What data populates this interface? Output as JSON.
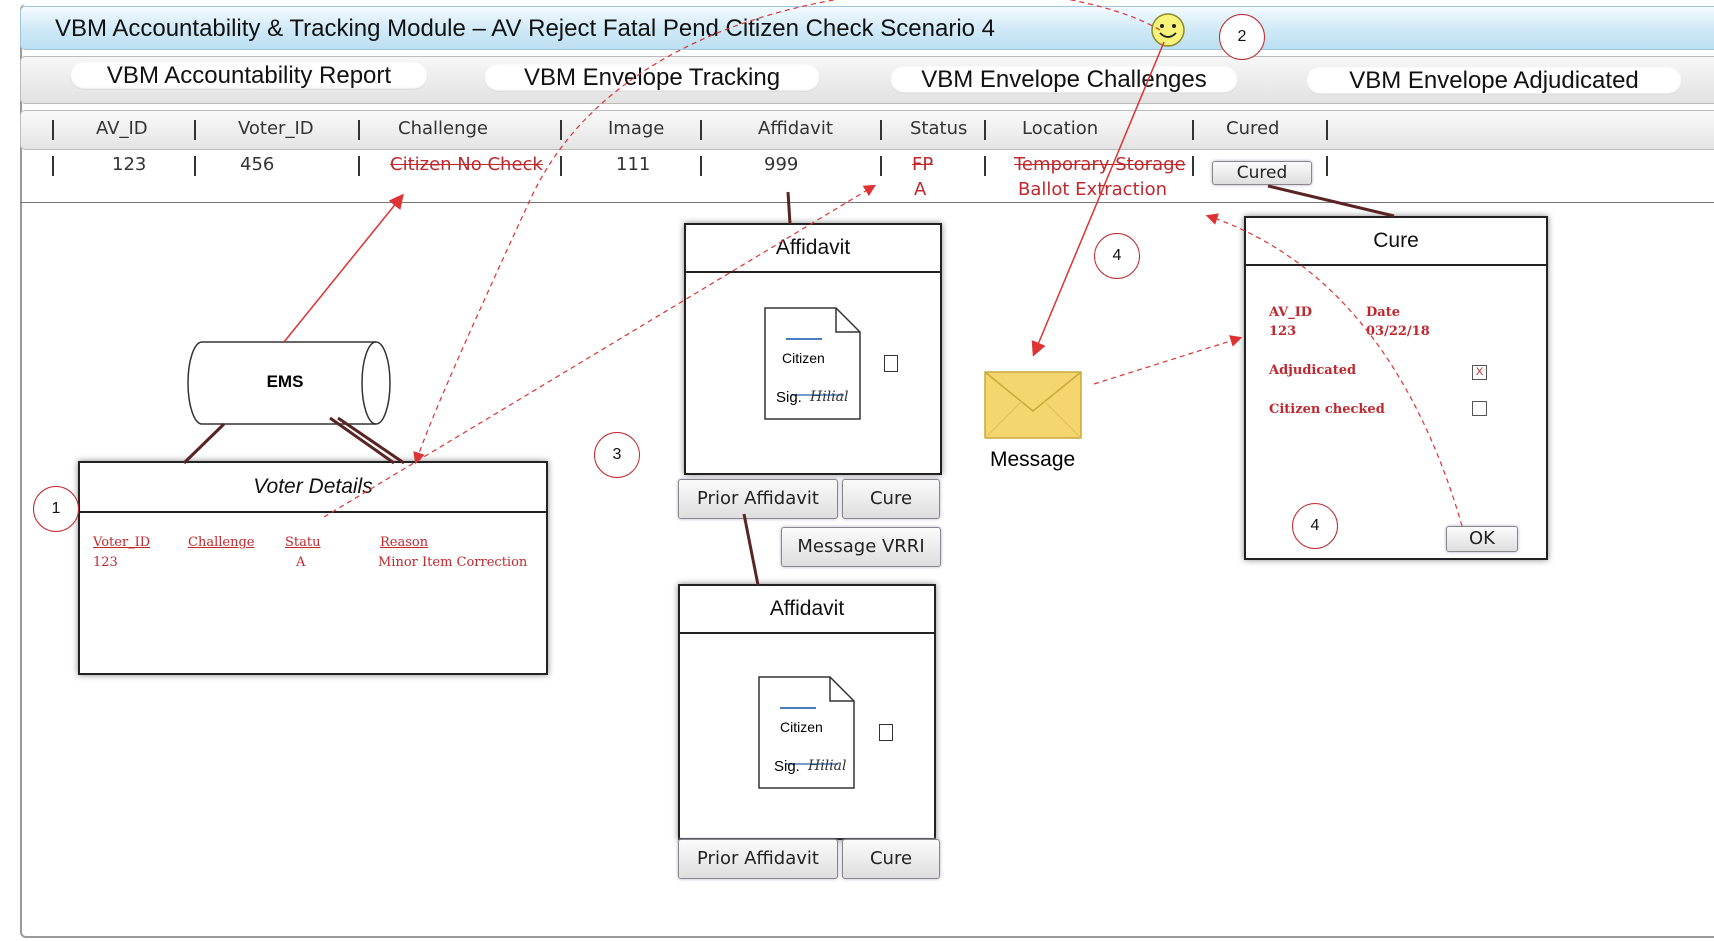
{
  "app_title": "VBM Accountability & Tracking Module – AV Reject Fatal Pend Citizen Check Scenario 4",
  "tabs": [
    "VBM Accountability Report",
    "VBM Envelope Tracking",
    "VBM Envelope Challenges",
    "VBM Envelope Adjudicated"
  ],
  "table": {
    "headers": [
      "AV_ID",
      "Voter_ID",
      "Challenge",
      "Image",
      "Affidavit",
      "Status",
      "Location",
      "Cured"
    ],
    "row": {
      "av_id": "123",
      "voter_id": "456",
      "challenge": "Citizen No Check",
      "image": "111",
      "affidavit": "999",
      "status_old": "FP",
      "status_new": "A",
      "location_old": "Temporary Storage",
      "location_new": "Ballot Extraction",
      "cured_button": "Cured"
    }
  },
  "ems_label": "EMS",
  "voter_details": {
    "title": "Voter Details",
    "headers": [
      "Voter_ID",
      "Challenge",
      "Statu",
      "Reason"
    ],
    "values": [
      "123",
      "",
      "A",
      "Minor Item Correction"
    ]
  },
  "affidavit_top": {
    "title": "Affidavit",
    "doc_text": "Citizen",
    "sig_label": "Sig.",
    "signature": "Hilial",
    "buttons": {
      "prior": "Prior Affidavit",
      "cure": "Cure",
      "message": "Message VRRI"
    }
  },
  "affidavit_bottom": {
    "title": "Affidavit",
    "doc_text": "Citizen",
    "sig_label": "Sig.",
    "signature": "Hilial",
    "buttons": {
      "prior": "Prior Affidavit",
      "cure": "Cure"
    }
  },
  "message_label": "Message",
  "cure_window": {
    "title": "Cure",
    "av_id_label": "AV_ID",
    "av_id": "123",
    "date_label": "Date",
    "date": "03/22/18",
    "adjudicated_label": "Adjudicated",
    "adjudicated_mark": "X",
    "citizen_label": "Citizen checked",
    "ok": "OK"
  },
  "markers": [
    "1",
    "2",
    "3",
    "4",
    "4"
  ],
  "colors": {
    "accent_red": "#c0282e",
    "title_blue": "#cfe9f7",
    "envelope": "#f5d66e"
  }
}
